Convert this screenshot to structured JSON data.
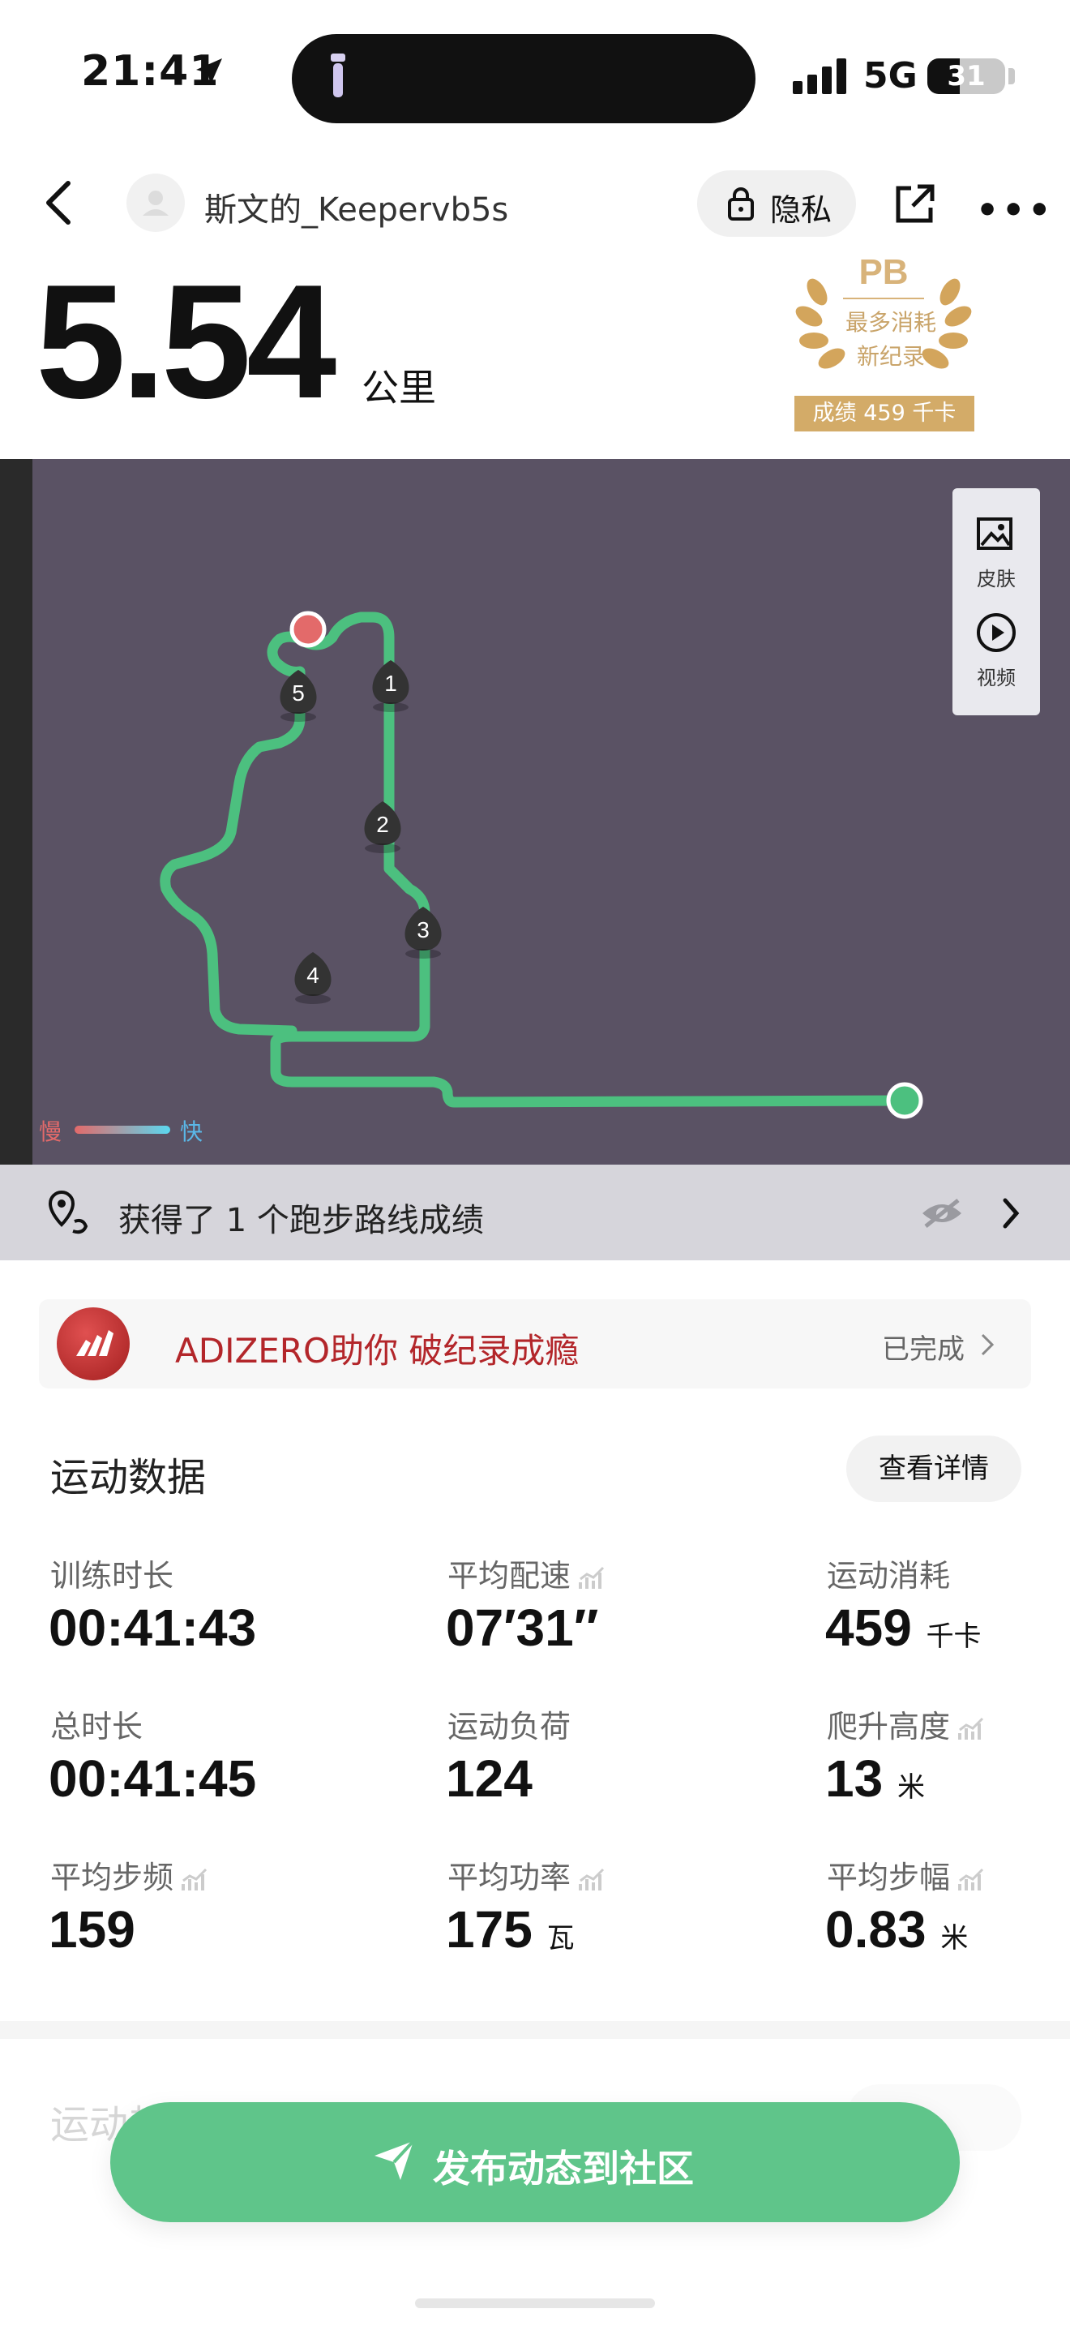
{
  "status_bar": {
    "time": "21:41",
    "network": "5G",
    "battery": "31"
  },
  "header": {
    "username": "斯文的_Keepervb5s",
    "privacy_label": "隐私"
  },
  "summary": {
    "distance": "5.54",
    "distance_unit": "公里"
  },
  "pb_badge": {
    "title": "PB",
    "line1": "最多消耗",
    "line2": "新纪录",
    "score": "成绩 459 千卡"
  },
  "map": {
    "tools": [
      {
        "label": "皮肤",
        "icon": "image-icon"
      },
      {
        "label": "视频",
        "icon": "play-icon"
      }
    ],
    "km_markers": [
      "1",
      "2",
      "3",
      "4",
      "5"
    ],
    "legend": {
      "slow": "慢",
      "fast": "快"
    },
    "route_color": "#4cc07f"
  },
  "route_banner": {
    "text": "获得了 1 个跑步路线成绩"
  },
  "promo": {
    "text": "ADIZERO助你 破纪录成瘾",
    "status": "已完成"
  },
  "stats": {
    "title": "运动数据",
    "detail_label": "查看详情",
    "items": [
      {
        "label": "训练时长",
        "value": "00:41:43",
        "unit": ""
      },
      {
        "label": "平均配速",
        "value": "07′31″",
        "unit": ""
      },
      {
        "label": "运动消耗",
        "value": "459",
        "unit": "千卡"
      },
      {
        "label": "总时长",
        "value": "00:41:45",
        "unit": ""
      },
      {
        "label": "运动负荷",
        "value": "124",
        "unit": ""
      },
      {
        "label": "爬升高度",
        "value": "13",
        "unit": "米"
      },
      {
        "label": "平均步频",
        "value": "159",
        "unit": ""
      },
      {
        "label": "平均功率",
        "value": "175",
        "unit": "瓦"
      },
      {
        "label": "平均步幅",
        "value": "0.83",
        "unit": "米"
      }
    ]
  },
  "next_section": {
    "title": "运动趋势"
  },
  "publish": {
    "label": "发布动态到社区"
  }
}
